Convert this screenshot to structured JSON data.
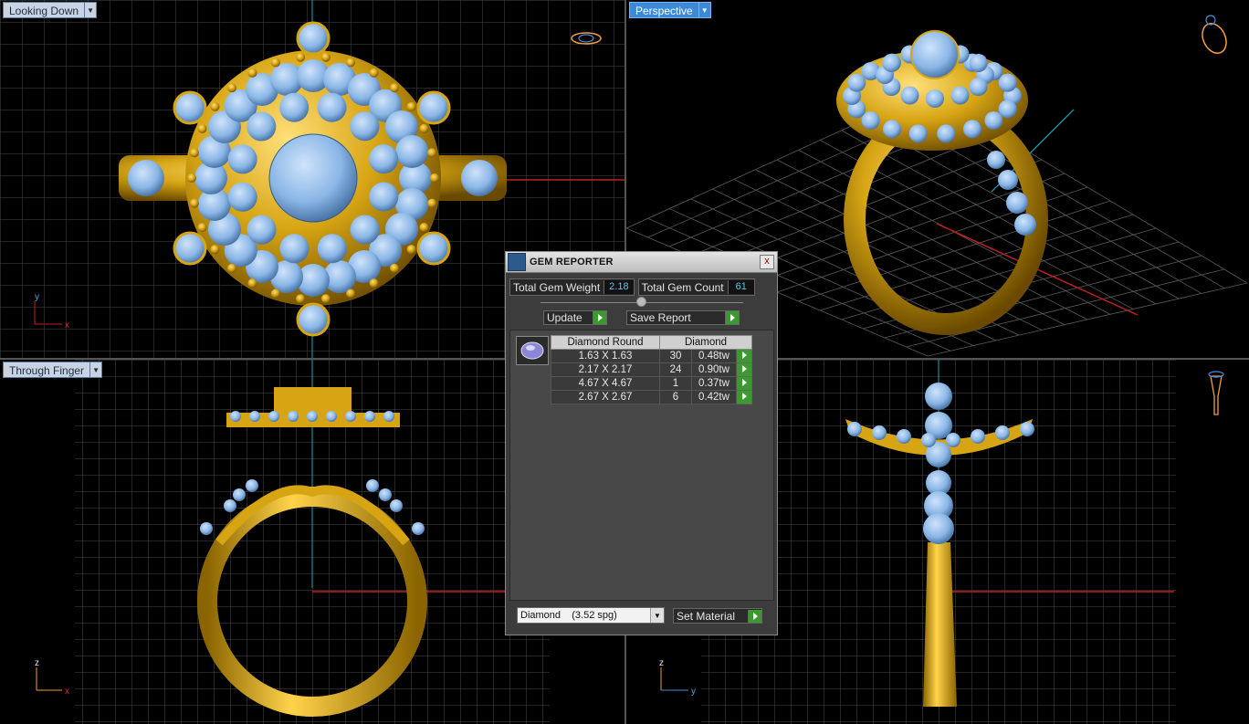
{
  "viewports": {
    "top_left": {
      "label": "Looking Down",
      "axis_a": "y",
      "axis_b": "x"
    },
    "top_right": {
      "label": "Perspective"
    },
    "bottom_left": {
      "label": "Through Finger",
      "axis_a": "z",
      "axis_b": "x"
    },
    "bottom_right": {
      "axis_a": "z",
      "axis_b": "y"
    }
  },
  "gem_reporter": {
    "title": "GEM REPORTER",
    "close": "x",
    "total_gem_weight_label": "Total Gem Weight",
    "total_gem_weight": "2.18",
    "total_gem_count_label": "Total Gem Count",
    "total_gem_count": "61",
    "update_label": "Update",
    "save_report_label": "Save Report",
    "table": {
      "col_shape": "Diamond Round",
      "col_material": "Diamond",
      "rows": [
        {
          "size": "1.63 X 1.63",
          "count": "30",
          "weight": "0.48tw"
        },
        {
          "size": "2.17 X 2.17",
          "count": "24",
          "weight": "0.90tw"
        },
        {
          "size": "4.67 X 4.67",
          "count": "1",
          "weight": "0.37tw"
        },
        {
          "size": "2.67 X 2.67",
          "count": "6",
          "weight": "0.42tw"
        }
      ]
    },
    "material_select": "Diamond    (3.52 spg)",
    "set_material_label": "Set Material"
  },
  "colors": {
    "gold": "#d7a514",
    "stone": "#8ab6e6",
    "accent_label": "#3b8ad8",
    "value_text": "#5dc4f2",
    "go_button": "#3b9a2e"
  }
}
